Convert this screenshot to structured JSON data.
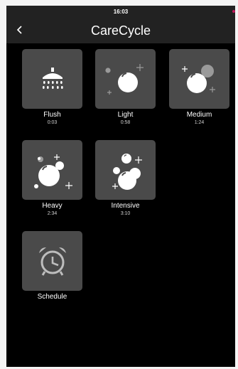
{
  "statusbar": {
    "time": "16:03"
  },
  "header": {
    "title": "CareCycle",
    "back_icon": "chevron-left-icon"
  },
  "programs": [
    {
      "name": "Flush",
      "time": "0:03",
      "icon": "shower-icon"
    },
    {
      "name": "Light",
      "time": "0:58",
      "icon": "bubble-light-icon"
    },
    {
      "name": "Medium",
      "time": "1:24",
      "icon": "bubble-medium-icon"
    },
    {
      "name": "Heavy",
      "time": "2:34",
      "icon": "bubble-heavy-icon"
    },
    {
      "name": "Intensive",
      "time": "3:10",
      "icon": "bubble-intensive-icon"
    },
    {
      "name": "Schedule",
      "time": "",
      "icon": "alarm-clock-icon"
    }
  ],
  "colors": {
    "background": "#000000",
    "header": "#222222",
    "tile": "#4a4a4a",
    "icon": "#ffffff",
    "icon_muted": "#9a9a9a"
  }
}
